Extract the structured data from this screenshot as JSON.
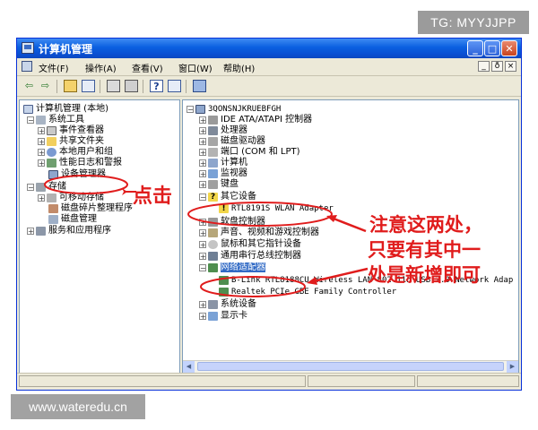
{
  "watermarks": {
    "top": "TG: MYYJJPP",
    "bottom": "www.wateredu.cn"
  },
  "window": {
    "title": "计算机管理",
    "buttons": {
      "minimize": "_",
      "maximize": "□",
      "close": "✕"
    }
  },
  "menubar": {
    "items": [
      "文件(F)",
      "操作(A)",
      "查看(V)",
      "窗口(W)",
      "帮助(H)"
    ],
    "mdi_buttons": [
      "_",
      "ð",
      "×"
    ]
  },
  "toolbar": {
    "icons": [
      "back-icon",
      "forward-icon",
      "up-folder-icon",
      "show-tree-icon",
      "properties-icon",
      "print-icon",
      "help-icon",
      "console-icon",
      "computer-icon"
    ]
  },
  "left_tree": [
    {
      "label": "计算机管理 (本地)",
      "expander": ""
    },
    {
      "label": "系统工具",
      "expander": "−"
    },
    {
      "label": "事件查看器",
      "expander": "+"
    },
    {
      "label": "共享文件夹",
      "expander": "+"
    },
    {
      "label": "本地用户和组",
      "expander": "+"
    },
    {
      "label": "性能日志和警报",
      "expander": "+"
    },
    {
      "label": "设备管理器",
      "expander": ""
    },
    {
      "label": "存储",
      "expander": "−"
    },
    {
      "label": "可移动存储",
      "expander": "+"
    },
    {
      "label": "磁盘碎片整理程序",
      "expander": ""
    },
    {
      "label": "磁盘管理",
      "expander": ""
    },
    {
      "label": "服务和应用程序",
      "expander": "+"
    }
  ],
  "right_tree": [
    {
      "label": "3QONSNJKRUEBFGH",
      "expander": "−"
    },
    {
      "label": "IDE ATA/ATAPI 控制器",
      "expander": "+"
    },
    {
      "label": "处理器",
      "expander": "+"
    },
    {
      "label": "磁盘驱动器",
      "expander": "+"
    },
    {
      "label": "端口 (COM 和 LPT)",
      "expander": "+"
    },
    {
      "label": "计算机",
      "expander": "+"
    },
    {
      "label": "监视器",
      "expander": "+"
    },
    {
      "label": "键盘",
      "expander": "+"
    },
    {
      "label": "其它设备",
      "expander": "−"
    },
    {
      "label": "RTL8191S WLAN Adapter",
      "expander": ""
    },
    {
      "label": "软盘控制器",
      "expander": "+"
    },
    {
      "label": "声音、视频和游戏控制器",
      "expander": "+"
    },
    {
      "label": "鼠标和其它指针设备",
      "expander": "+"
    },
    {
      "label": "通用串行总线控制器",
      "expander": "+"
    },
    {
      "label": "网络适配器",
      "expander": "−"
    },
    {
      "label": "B-Link RTL8188CU Wireless LAN 802.11n USB 2.0 Network Adap",
      "expander": ""
    },
    {
      "label": "Realtek PCIe GBE Family Controller",
      "expander": ""
    },
    {
      "label": "系统设备",
      "expander": "+"
    },
    {
      "label": "显示卡",
      "expander": "+"
    }
  ],
  "annotations": {
    "click_here": "点击",
    "note_line1": "注意这两处，",
    "note_line2": "只要有其中一",
    "note_line3": "处是新增即可"
  },
  "colors": {
    "title_bar": "#0a5fe0",
    "annotation": "#e01c1c",
    "selection": "#316ac5",
    "window_bg": "#ece9d8"
  }
}
